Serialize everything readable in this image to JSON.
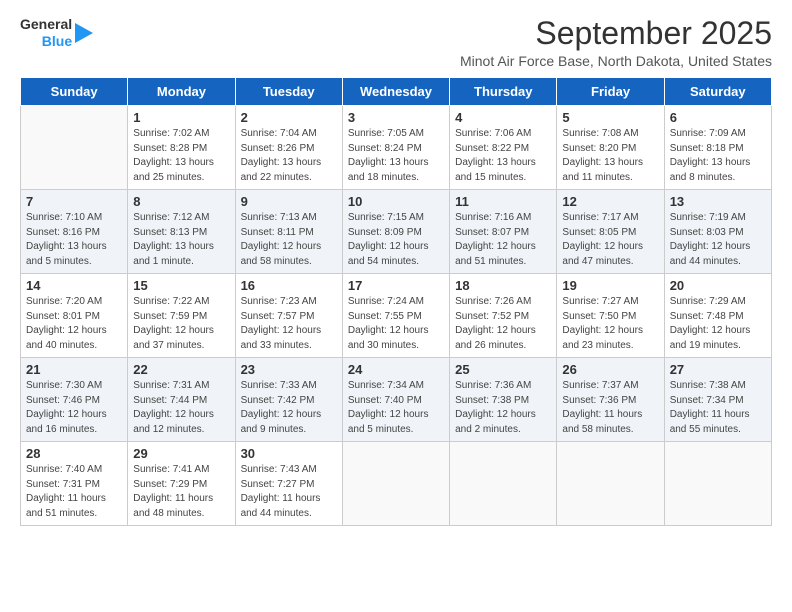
{
  "header": {
    "logo_general": "General",
    "logo_blue": "Blue",
    "title": "September 2025",
    "subtitle": "Minot Air Force Base, North Dakota, United States"
  },
  "days_of_week": [
    "Sunday",
    "Monday",
    "Tuesday",
    "Wednesday",
    "Thursday",
    "Friday",
    "Saturday"
  ],
  "weeks": [
    [
      {
        "day": "",
        "details": []
      },
      {
        "day": "1",
        "details": [
          "Sunrise: 7:02 AM",
          "Sunset: 8:28 PM",
          "Daylight: 13 hours",
          "and 25 minutes."
        ]
      },
      {
        "day": "2",
        "details": [
          "Sunrise: 7:04 AM",
          "Sunset: 8:26 PM",
          "Daylight: 13 hours",
          "and 22 minutes."
        ]
      },
      {
        "day": "3",
        "details": [
          "Sunrise: 7:05 AM",
          "Sunset: 8:24 PM",
          "Daylight: 13 hours",
          "and 18 minutes."
        ]
      },
      {
        "day": "4",
        "details": [
          "Sunrise: 7:06 AM",
          "Sunset: 8:22 PM",
          "Daylight: 13 hours",
          "and 15 minutes."
        ]
      },
      {
        "day": "5",
        "details": [
          "Sunrise: 7:08 AM",
          "Sunset: 8:20 PM",
          "Daylight: 13 hours",
          "and 11 minutes."
        ]
      },
      {
        "day": "6",
        "details": [
          "Sunrise: 7:09 AM",
          "Sunset: 8:18 PM",
          "Daylight: 13 hours",
          "and 8 minutes."
        ]
      }
    ],
    [
      {
        "day": "7",
        "details": [
          "Sunrise: 7:10 AM",
          "Sunset: 8:16 PM",
          "Daylight: 13 hours",
          "and 5 minutes."
        ]
      },
      {
        "day": "8",
        "details": [
          "Sunrise: 7:12 AM",
          "Sunset: 8:13 PM",
          "Daylight: 13 hours",
          "and 1 minute."
        ]
      },
      {
        "day": "9",
        "details": [
          "Sunrise: 7:13 AM",
          "Sunset: 8:11 PM",
          "Daylight: 12 hours",
          "and 58 minutes."
        ]
      },
      {
        "day": "10",
        "details": [
          "Sunrise: 7:15 AM",
          "Sunset: 8:09 PM",
          "Daylight: 12 hours",
          "and 54 minutes."
        ]
      },
      {
        "day": "11",
        "details": [
          "Sunrise: 7:16 AM",
          "Sunset: 8:07 PM",
          "Daylight: 12 hours",
          "and 51 minutes."
        ]
      },
      {
        "day": "12",
        "details": [
          "Sunrise: 7:17 AM",
          "Sunset: 8:05 PM",
          "Daylight: 12 hours",
          "and 47 minutes."
        ]
      },
      {
        "day": "13",
        "details": [
          "Sunrise: 7:19 AM",
          "Sunset: 8:03 PM",
          "Daylight: 12 hours",
          "and 44 minutes."
        ]
      }
    ],
    [
      {
        "day": "14",
        "details": [
          "Sunrise: 7:20 AM",
          "Sunset: 8:01 PM",
          "Daylight: 12 hours",
          "and 40 minutes."
        ]
      },
      {
        "day": "15",
        "details": [
          "Sunrise: 7:22 AM",
          "Sunset: 7:59 PM",
          "Daylight: 12 hours",
          "and 37 minutes."
        ]
      },
      {
        "day": "16",
        "details": [
          "Sunrise: 7:23 AM",
          "Sunset: 7:57 PM",
          "Daylight: 12 hours",
          "and 33 minutes."
        ]
      },
      {
        "day": "17",
        "details": [
          "Sunrise: 7:24 AM",
          "Sunset: 7:55 PM",
          "Daylight: 12 hours",
          "and 30 minutes."
        ]
      },
      {
        "day": "18",
        "details": [
          "Sunrise: 7:26 AM",
          "Sunset: 7:52 PM",
          "Daylight: 12 hours",
          "and 26 minutes."
        ]
      },
      {
        "day": "19",
        "details": [
          "Sunrise: 7:27 AM",
          "Sunset: 7:50 PM",
          "Daylight: 12 hours",
          "and 23 minutes."
        ]
      },
      {
        "day": "20",
        "details": [
          "Sunrise: 7:29 AM",
          "Sunset: 7:48 PM",
          "Daylight: 12 hours",
          "and 19 minutes."
        ]
      }
    ],
    [
      {
        "day": "21",
        "details": [
          "Sunrise: 7:30 AM",
          "Sunset: 7:46 PM",
          "Daylight: 12 hours",
          "and 16 minutes."
        ]
      },
      {
        "day": "22",
        "details": [
          "Sunrise: 7:31 AM",
          "Sunset: 7:44 PM",
          "Daylight: 12 hours",
          "and 12 minutes."
        ]
      },
      {
        "day": "23",
        "details": [
          "Sunrise: 7:33 AM",
          "Sunset: 7:42 PM",
          "Daylight: 12 hours",
          "and 9 minutes."
        ]
      },
      {
        "day": "24",
        "details": [
          "Sunrise: 7:34 AM",
          "Sunset: 7:40 PM",
          "Daylight: 12 hours",
          "and 5 minutes."
        ]
      },
      {
        "day": "25",
        "details": [
          "Sunrise: 7:36 AM",
          "Sunset: 7:38 PM",
          "Daylight: 12 hours",
          "and 2 minutes."
        ]
      },
      {
        "day": "26",
        "details": [
          "Sunrise: 7:37 AM",
          "Sunset: 7:36 PM",
          "Daylight: 11 hours",
          "and 58 minutes."
        ]
      },
      {
        "day": "27",
        "details": [
          "Sunrise: 7:38 AM",
          "Sunset: 7:34 PM",
          "Daylight: 11 hours",
          "and 55 minutes."
        ]
      }
    ],
    [
      {
        "day": "28",
        "details": [
          "Sunrise: 7:40 AM",
          "Sunset: 7:31 PM",
          "Daylight: 11 hours",
          "and 51 minutes."
        ]
      },
      {
        "day": "29",
        "details": [
          "Sunrise: 7:41 AM",
          "Sunset: 7:29 PM",
          "Daylight: 11 hours",
          "and 48 minutes."
        ]
      },
      {
        "day": "30",
        "details": [
          "Sunrise: 7:43 AM",
          "Sunset: 7:27 PM",
          "Daylight: 11 hours",
          "and 44 minutes."
        ]
      },
      {
        "day": "",
        "details": []
      },
      {
        "day": "",
        "details": []
      },
      {
        "day": "",
        "details": []
      },
      {
        "day": "",
        "details": []
      }
    ]
  ]
}
